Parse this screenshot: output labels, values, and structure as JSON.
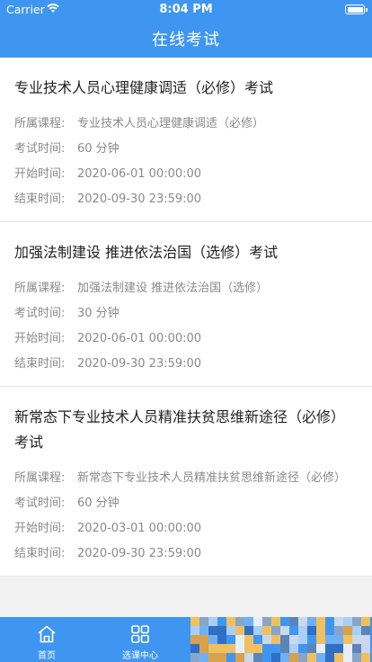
{
  "status_bar": {
    "carrier": "Carrier",
    "time": "8:04 PM"
  },
  "header": {
    "title": "在线考试"
  },
  "labels": {
    "course": "所属课程:",
    "duration": "考试时间:",
    "start": "开始时间:",
    "end": "结束时间:"
  },
  "exams": [
    {
      "title": "专业技术人员心理健康调适（必修）考试",
      "course": "专业技术人员心理健康调适（必修）",
      "duration": "60 分钟",
      "start": "2020-06-01 00:00:00",
      "end": "2020-09-30 23:59:00"
    },
    {
      "title": "加强法制建设 推进依法治国（选修）考试",
      "course": "加强法制建设 推进依法治国（选修）",
      "duration": "30 分钟",
      "start": "2020-06-01 00:00:00",
      "end": "2020-09-30 23:59:00"
    },
    {
      "title": "新常态下专业技术人员精准扶贫思维新途径（必修）考试",
      "course": "新常态下专业技术人员精准扶贫思维新途径（必修）",
      "duration": "60 分钟",
      "start": "2020-03-01 00:00:00",
      "end": "2020-09-30 23:59:00"
    }
  ],
  "tabbar": {
    "tabs": [
      {
        "label": "首页",
        "icon": "home-icon"
      },
      {
        "label": "选课中心",
        "icon": "grid-icon"
      }
    ]
  },
  "colors": {
    "primary": "#3f96f0"
  }
}
